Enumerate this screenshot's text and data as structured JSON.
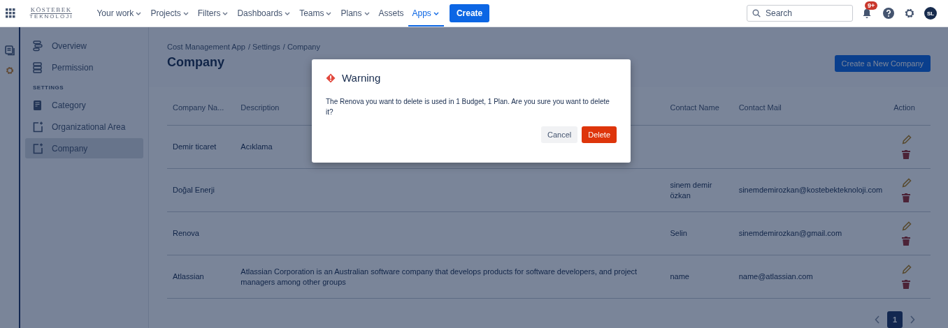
{
  "topbar": {
    "logo": {
      "line_1": "KÖSTEBEK",
      "line_2": "TEKNOLOJI"
    },
    "nav": [
      {
        "label": "Your work",
        "dropdown": true,
        "selected": false
      },
      {
        "label": "Projects",
        "dropdown": true,
        "selected": false
      },
      {
        "label": "Filters",
        "dropdown": true,
        "selected": false
      },
      {
        "label": "Dashboards",
        "dropdown": true,
        "selected": false
      },
      {
        "label": "Teams",
        "dropdown": true,
        "selected": false
      },
      {
        "label": "Plans",
        "dropdown": true,
        "selected": false
      },
      {
        "label": "Assets",
        "dropdown": false,
        "selected": false
      },
      {
        "label": "Apps",
        "dropdown": true,
        "selected": true
      }
    ],
    "create_button": "Create",
    "search": {
      "placeholder": "Search"
    },
    "notifications_badge": "9+",
    "avatar": "SL"
  },
  "sidebar": {
    "items": [
      {
        "label": "Overview",
        "kind": "overview",
        "selected": false
      },
      {
        "label": "Permission",
        "kind": "permission",
        "selected": false
      }
    ],
    "section": "SETTINGS",
    "settings_items": [
      {
        "label": "Category",
        "kind": "category",
        "selected": false
      },
      {
        "label": "Organizational Area",
        "kind": "add",
        "selected": false
      },
      {
        "label": "Company",
        "kind": "add",
        "selected": true
      }
    ]
  },
  "page": {
    "breadcrumbs": [
      "Cost Management App",
      "/ Settings",
      "/ Company"
    ],
    "title": "Company",
    "new_button": "Create a New Company"
  },
  "table": {
    "columns": [
      "Company Na...",
      "Description",
      "Contact Name",
      "Contact Mail",
      "Action"
    ],
    "rows": [
      {
        "company": "Demir ticaret",
        "description": "Acıklama",
        "contact_name": "",
        "contact_mail": ""
      },
      {
        "company": "Doğal Enerji",
        "description": "",
        "contact_name": "sinem demir özkan",
        "contact_mail": "sinemdemirozkan@kostebekteknoloji.com"
      },
      {
        "company": "Renova",
        "description": "",
        "contact_name": "Selin",
        "contact_mail": "sinemdemirozkan@gmail.com"
      },
      {
        "company": "Atlassian",
        "description": "Atlassian Corporation is an Australian software company that develops products for software developers, and project managers among other groups",
        "contact_name": "name",
        "contact_mail": "name@atlassian.com"
      }
    ]
  },
  "pagination": {
    "pages": [
      {
        "label": "1",
        "selected": true
      }
    ]
  },
  "dialog": {
    "title": "Warning",
    "message": "The Renova you want to delete is used in 1 Budget, 1 Plan. Are you sure you want to delete it?",
    "buttons": [
      {
        "label": "Cancel",
        "kind": "subtle"
      },
      {
        "label": "Delete",
        "kind": "danger"
      }
    ]
  }
}
